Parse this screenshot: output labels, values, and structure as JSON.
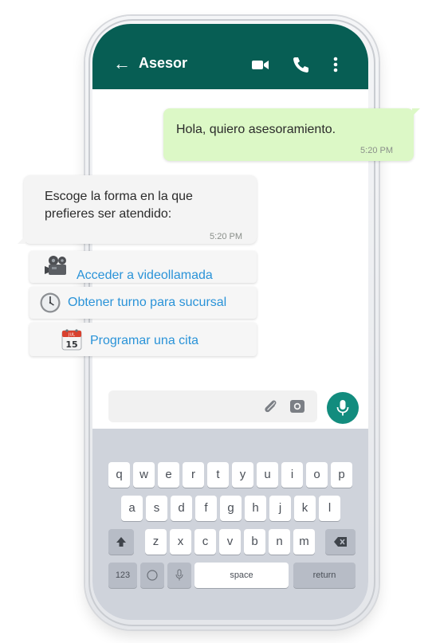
{
  "header": {
    "back_icon": "arrow-left-icon",
    "title": "Asesor",
    "icons": [
      "video-camera-icon",
      "phone-icon",
      "more-vert-icon"
    ]
  },
  "messages": {
    "outgoing": {
      "text": "Hola, quiero asesoramiento.",
      "time": "5:20 PM"
    },
    "incoming": {
      "text_line1": "Escoge la forma en la que",
      "text_line2": "prefieres ser atendido:",
      "time": "5:20 PM"
    }
  },
  "options": [
    {
      "label": "Acceder a videollamada",
      "icon": "movie-camera-icon"
    },
    {
      "label": "Obtener turno para sucursal",
      "icon": "clock-icon"
    },
    {
      "label": "Programar una cita",
      "icon": "calendar-icon",
      "calendar_month": "JUL",
      "calendar_day": "15"
    }
  ],
  "composer": {
    "attach_icon": "paperclip-icon",
    "camera_icon": "camera-icon",
    "mic_icon": "microphone-icon"
  },
  "keyboard": {
    "row1": [
      "q",
      "w",
      "e",
      "r",
      "t",
      "y",
      "u",
      "i",
      "o",
      "p"
    ],
    "row2": [
      "a",
      "s",
      "d",
      "f",
      "g",
      "h",
      "j",
      "k",
      "l"
    ],
    "row3": [
      "z",
      "x",
      "c",
      "v",
      "b",
      "n",
      "m"
    ],
    "numbers_label": "123",
    "space_label": "space",
    "return_label": "return"
  },
  "colors": {
    "header": "#075e54",
    "outgoing_bubble": "#dcf8c6",
    "incoming_bubble": "#f4f4f4",
    "link": "#2a93d8",
    "mic": "#128c7e",
    "keyboard": "#cfd3db"
  }
}
